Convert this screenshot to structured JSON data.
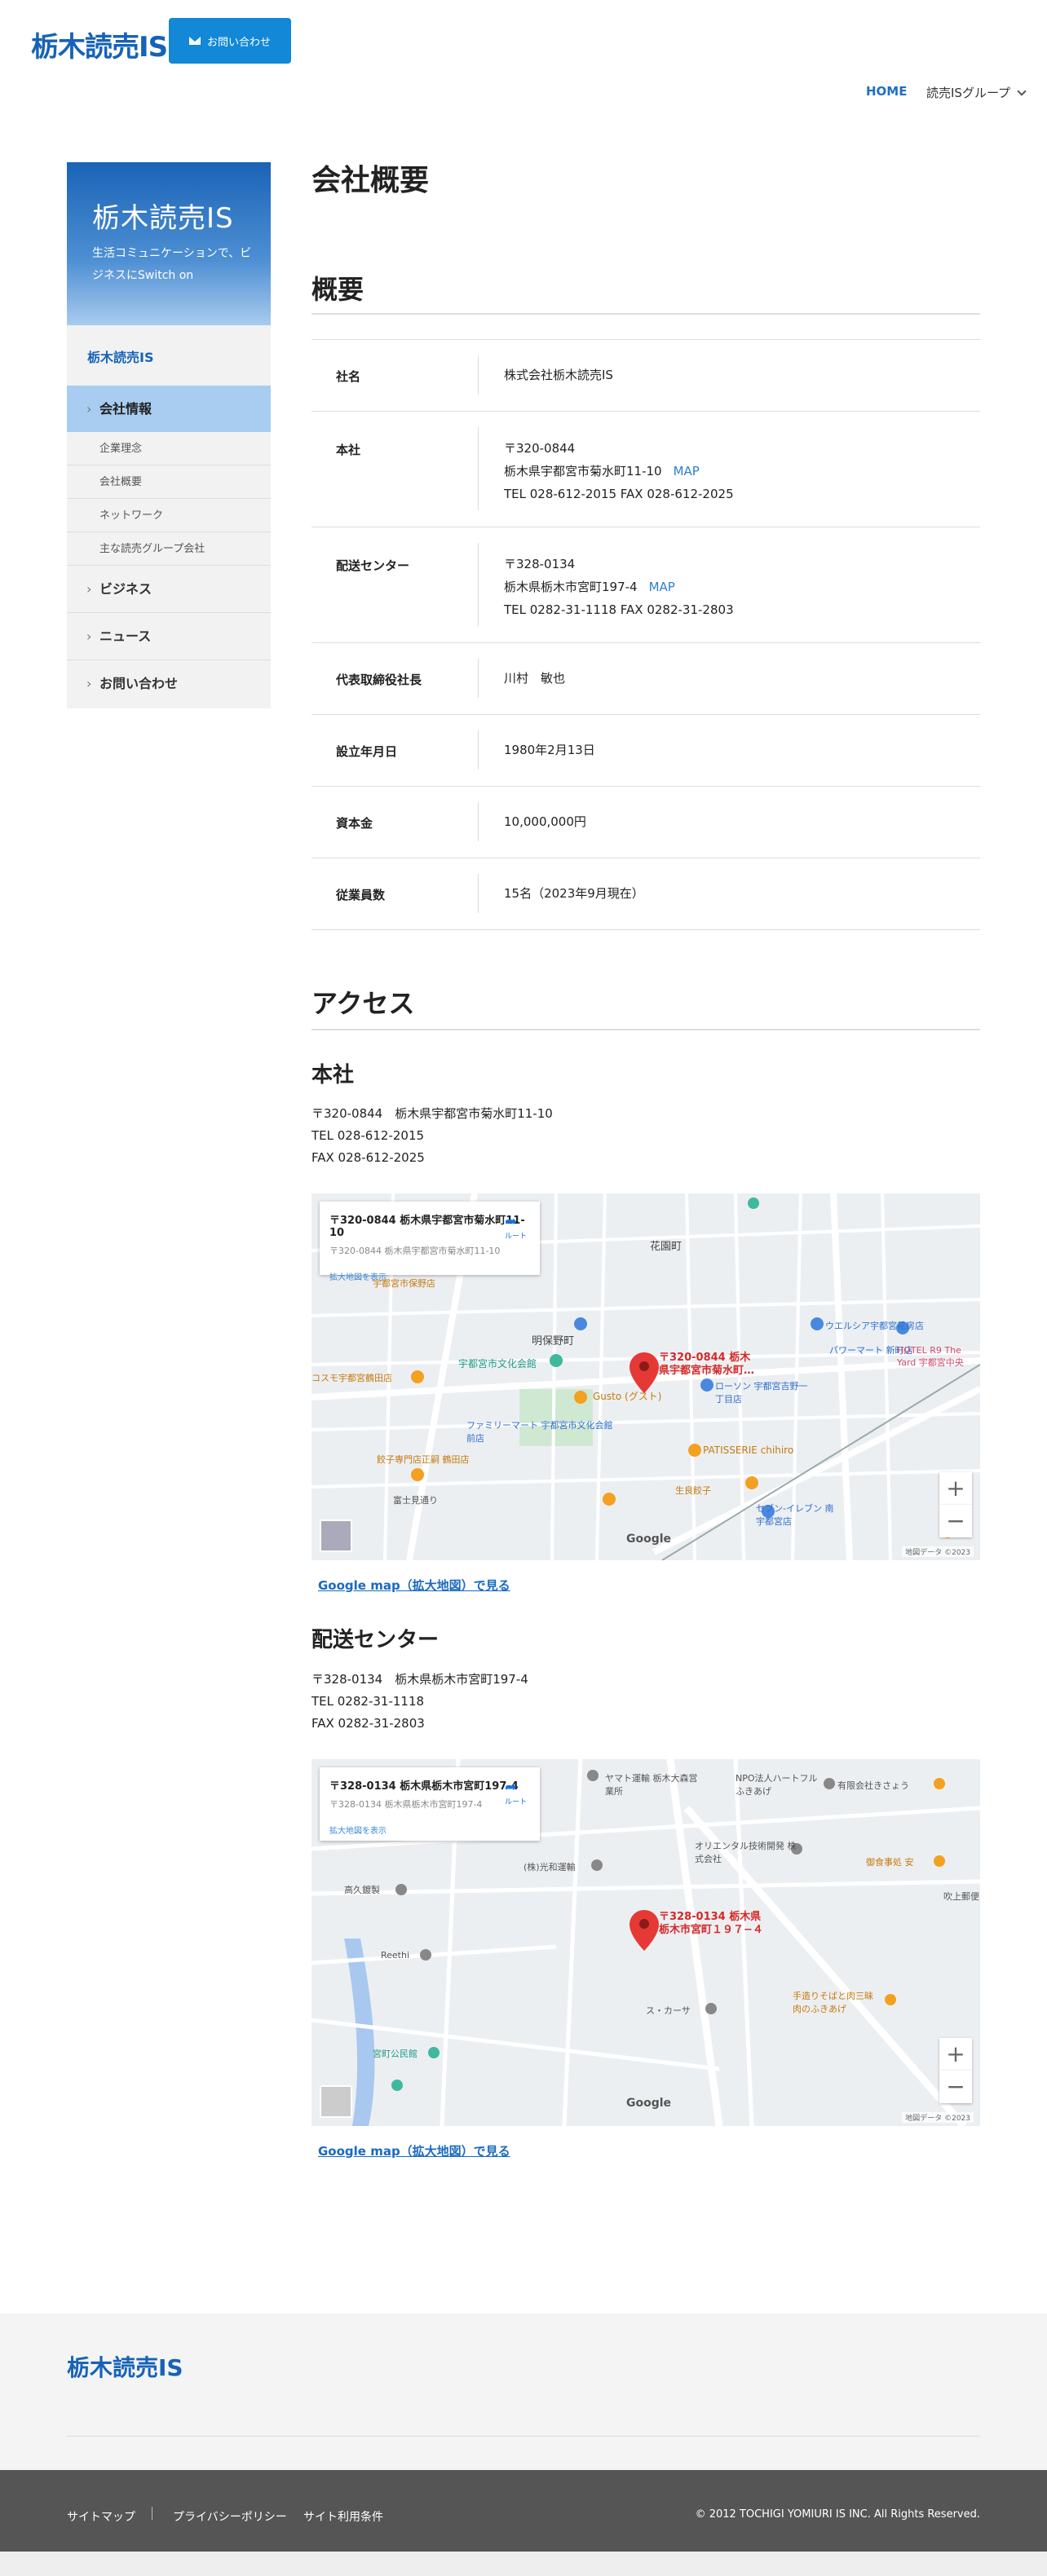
{
  "header": {
    "logo": "栃木読売IS",
    "contact_button": "お問い合わせ",
    "nav": {
      "home": "HOME",
      "group": "読売ISグループ"
    }
  },
  "sidebar": {
    "hero_title": "栃木読売IS",
    "hero_sub": "生活コミュニケーションで、ビジネスにSwitch on",
    "heading": "栃木読売IS",
    "active": "会社情報",
    "subitems": [
      "企業理念",
      "会社概要",
      "ネットワーク",
      "主な読売グループ会社"
    ],
    "items": [
      "ビジネス",
      "ニュース",
      "お問い合わせ"
    ]
  },
  "main": {
    "title": "会社概要",
    "overview_title": "概要",
    "table": [
      {
        "label": "社名",
        "lines": [
          "株式会社栃木読売IS"
        ]
      },
      {
        "label": "本社",
        "lines": [
          "〒320-0844",
          "栃木県宇都宮市菊水町11-10",
          "TEL 028-612-2015 FAX 028-612-2025"
        ],
        "map": "MAP"
      },
      {
        "label": "配送センター",
        "lines": [
          "〒328-0134",
          "栃木県栃木市宮町197-4",
          "TEL 0282-31-1118 FAX 0282-31-2803"
        ],
        "map": "MAP"
      },
      {
        "label": "代表取締役社長",
        "lines": [
          "川村　敏也"
        ]
      },
      {
        "label": "設立年月日",
        "lines": [
          "1980年2月13日"
        ]
      },
      {
        "label": "資本金",
        "lines": [
          "10,000,000円"
        ]
      },
      {
        "label": "従業員数",
        "lines": [
          "15名（2023年9月現在）"
        ]
      }
    ],
    "access_title": "アクセス",
    "hq": {
      "title": "本社",
      "lines": [
        "〒320-0844　栃木県宇都宮市菊水町11-10",
        "TEL 028-612-2015",
        "FAX 028-612-2025"
      ],
      "map_card_title": "〒320-0844 栃木県宇都宮市菊水町11-10",
      "map_card_sub": "〒320-0844 栃木県宇都宮市菊水町11-10",
      "map_card_link": "拡大地図を表示",
      "directions": "ルート",
      "pin_label_1": "〒320-0844 栃木",
      "pin_label_2": "県宇都宮市菊水町…",
      "map_link": "Google map（拡大地図）で見る",
      "labels": [
        "花園町",
        "明保野町",
        "宇都宮市文化会館",
        "Gusto (グスト)",
        "ローソン 宇都宮吉野一丁目店",
        "ウエルシア宇都宮花房店",
        "パワーマート 新町店",
        "PATISSERIE chihiro",
        "生良餃子",
        "セブン-イレブン 南宇都宮店",
        "ファミリーマート 宇都宮市文化会館前店",
        "餃子専門店正嗣 鶴田店",
        "富士見通り",
        "宇都宮市保野店",
        "コスモ宇都宮鶴田店",
        "HOTEL R9 The Yard 宇都宮中央"
      ]
    },
    "center": {
      "title": "配送センター",
      "lines": [
        "〒328-0134　栃木県栃木市宮町197-4",
        "TEL 0282-31-1118",
        "FAX 0282-31-2803"
      ],
      "map_card_title": "〒328-0134 栃木県栃木市宮町197-4",
      "map_card_sub": "〒328-0134 栃木県栃木市宮町197-4",
      "map_card_link": "拡大地図を表示",
      "directions": "ルート",
      "pin_label_1": "〒328-0134 栃木県",
      "pin_label_2": "栃木市宮町１９７−４",
      "map_link": "Google map（拡大地図）で見る",
      "labels": [
        "ヤマト運輸 栃木大森営業所",
        "NPO法人ハートフルふきあげ",
        "有限会社きさょう",
        "オリエンタル技術開発 株式会社",
        "(株)光和運輸",
        "御食事処 安",
        "高久鍍製",
        "Reethi",
        "ス・カーサ",
        "手造りそばと肉三昧 肉のふきあげ",
        "宮町公民館",
        "吹上郵便"
      ]
    },
    "map_copyright": "地図データ ©2023"
  },
  "footer": {
    "logo": "栃木読売IS",
    "links": [
      "サイトマップ",
      "プライバシーポリシー",
      "サイト利用条件"
    ],
    "copyright": "© 2012 TOCHIGI YOMIURI IS INC. All Rights Reserved."
  }
}
